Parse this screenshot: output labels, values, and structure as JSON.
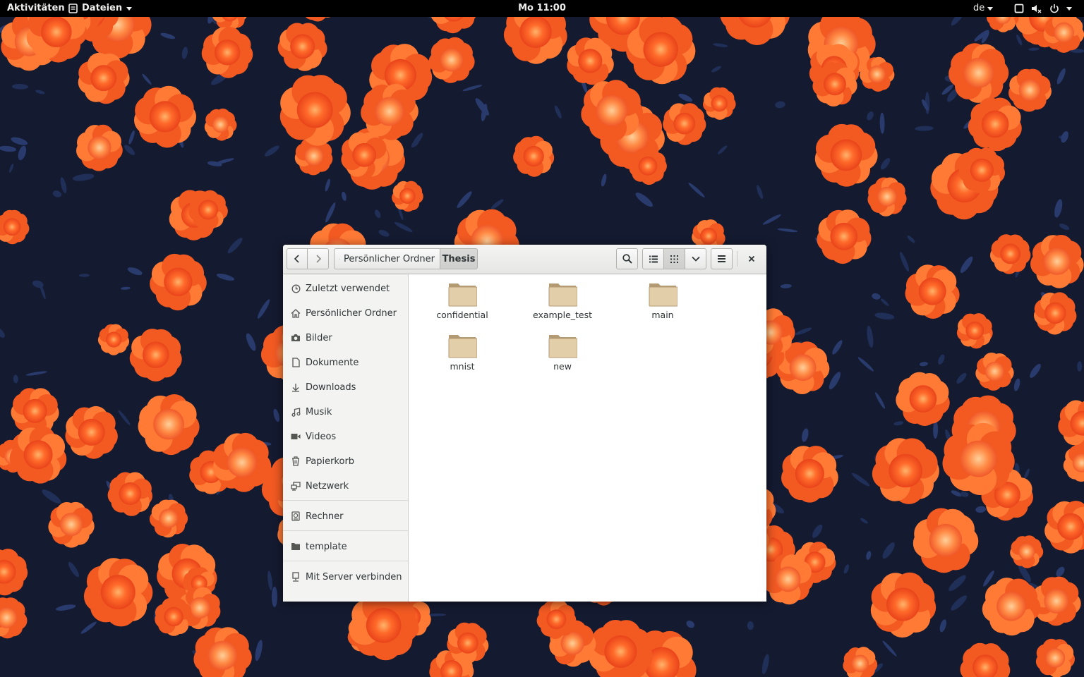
{
  "topbar": {
    "activities": "Aktivitäten",
    "app_name": "Dateien",
    "clock": "Mo 11:00",
    "language": "de"
  },
  "window": {
    "breadcrumb": {
      "home": "Persönlicher Ordner",
      "current": "Thesis"
    },
    "sidebar": {
      "items": [
        {
          "label": "Zuletzt verwendet",
          "icon": "clock-icon"
        },
        {
          "label": "Persönlicher Ordner",
          "icon": "home-icon"
        },
        {
          "label": "Bilder",
          "icon": "camera-icon"
        },
        {
          "label": "Dokumente",
          "icon": "document-icon"
        },
        {
          "label": "Downloads",
          "icon": "download-icon"
        },
        {
          "label": "Musik",
          "icon": "music-icon"
        },
        {
          "label": "Videos",
          "icon": "video-icon"
        },
        {
          "label": "Papierkorb",
          "icon": "trash-icon"
        },
        {
          "label": "Netzwerk",
          "icon": "network-icon"
        },
        {
          "label": "Rechner",
          "icon": "computer-icon"
        },
        {
          "label": "template",
          "icon": "folder-icon"
        },
        {
          "label": "Mit Server verbinden",
          "icon": "server-icon"
        }
      ]
    },
    "files": [
      {
        "name": "confidential",
        "type": "folder"
      },
      {
        "name": "example_test",
        "type": "folder"
      },
      {
        "name": "main",
        "type": "folder"
      },
      {
        "name": "mnist",
        "type": "folder"
      },
      {
        "name": "new",
        "type": "folder"
      }
    ]
  },
  "colors": {
    "topbar_bg": "#000000",
    "window_bg": "#ffffff",
    "sidebar_bg": "#f3f3f2",
    "folder": "#d9c3a0",
    "wallpaper_dark": "#151a2e",
    "flower": "#ff5a1f"
  }
}
